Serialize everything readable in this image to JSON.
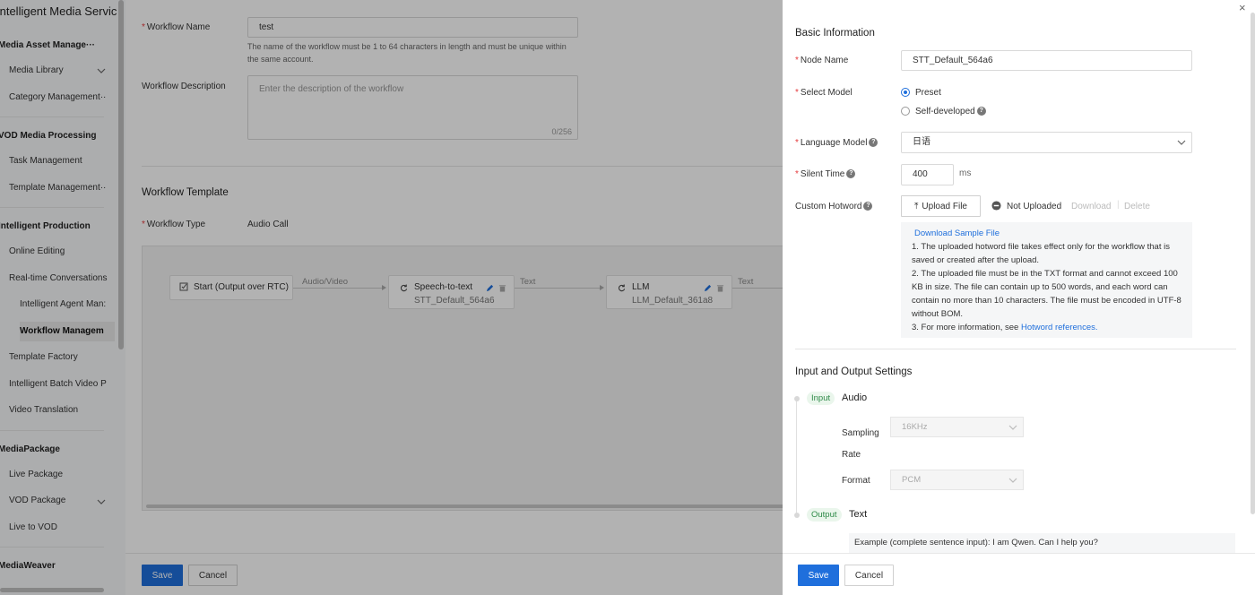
{
  "sidebar": {
    "title": "Intelligent Media Servic",
    "sections": [
      {
        "label": "Media Asset Manage···"
      },
      {
        "label": "VOD Media Processing"
      },
      {
        "label": "Intelligent Production"
      },
      {
        "label": "MediaPackage"
      },
      {
        "label": "MediaWeaver"
      }
    ],
    "items": [
      {
        "label": "Media Library"
      },
      {
        "label": "Category Management··"
      },
      {
        "label": "Task Management"
      },
      {
        "label": "Template Management··"
      },
      {
        "label": "Online Editing"
      },
      {
        "label": "Real-time Conversations"
      },
      {
        "label": "Intelligent Agent Man:"
      },
      {
        "label": "Workflow Managem"
      },
      {
        "label": "Template Factory"
      },
      {
        "label": "Intelligent Batch Video P"
      },
      {
        "label": "Video Translation"
      },
      {
        "label": "Live Package"
      },
      {
        "label": "VOD Package"
      },
      {
        "label": "Live to VOD"
      }
    ]
  },
  "form": {
    "workflow_name_label": "Workflow Name",
    "workflow_name_value": "test",
    "workflow_name_hint": "The name of the workflow must be 1 to 64 characters in length and must be unique within the same account.",
    "description_label": "Workflow Description",
    "description_placeholder": "Enter the description of the workflow",
    "description_counter": "0/256",
    "template_title": "Workflow Template",
    "workflow_type_label": "Workflow Type",
    "workflow_type_value": "Audio Call"
  },
  "canvas": {
    "start_node": "Start (Output over RTC)",
    "edge1": "Audio/Video",
    "stt_title": "Speech-to-text",
    "stt_sub": "STT_Default_564a6",
    "edge2": "Text",
    "llm_title": "LLM",
    "llm_sub": "LLM_Default_361a8",
    "edge3": "Text"
  },
  "footer": {
    "save": "Save",
    "cancel": "Cancel"
  },
  "drawer": {
    "basic_title": "Basic Information",
    "node_name_label": "Node Name",
    "node_name_value": "STT_Default_564a6",
    "select_model_label": "Select Model",
    "model_preset": "Preset",
    "model_self": "Self-developed",
    "language_model_label": "Language Model",
    "language_model_value": "日语",
    "silent_time_label": "Silent Time",
    "silent_time_value": "400",
    "silent_time_unit": "ms",
    "hotword_label": "Custom Hotword",
    "upload_file": "Upload File",
    "not_uploaded": "Not Uploaded",
    "download": "Download",
    "delete": "Delete",
    "sample_link": "Download Sample File",
    "note1": "1. The uploaded hotword file takes effect only for the workflow that is saved or created after the upload.",
    "note2": "2. The uploaded file must be in the TXT format and cannot exceed 100 KB in size. The file can contain up to 500 words, and each word can contain no more than 10 characters. The file must be encoded in UTF-8 without BOM.",
    "note3_prefix": "3. For more information, see",
    "note3_link": "Hotword references.",
    "io_title": "Input and Output Settings",
    "input_tag": "Input",
    "input_type": "Audio",
    "sampling_label": "Sampling Rate",
    "sampling_value": "16KHz",
    "format_label": "Format",
    "format_value": "PCM",
    "output_tag": "Output",
    "output_type": "Text",
    "example_text": "Example (complete sentence input): I am Qwen. Can I help you?",
    "save": "Save",
    "cancel": "Cancel"
  },
  "icons": {
    "primary_color": "#1f6fdc",
    "required_color": "#e4393c"
  }
}
